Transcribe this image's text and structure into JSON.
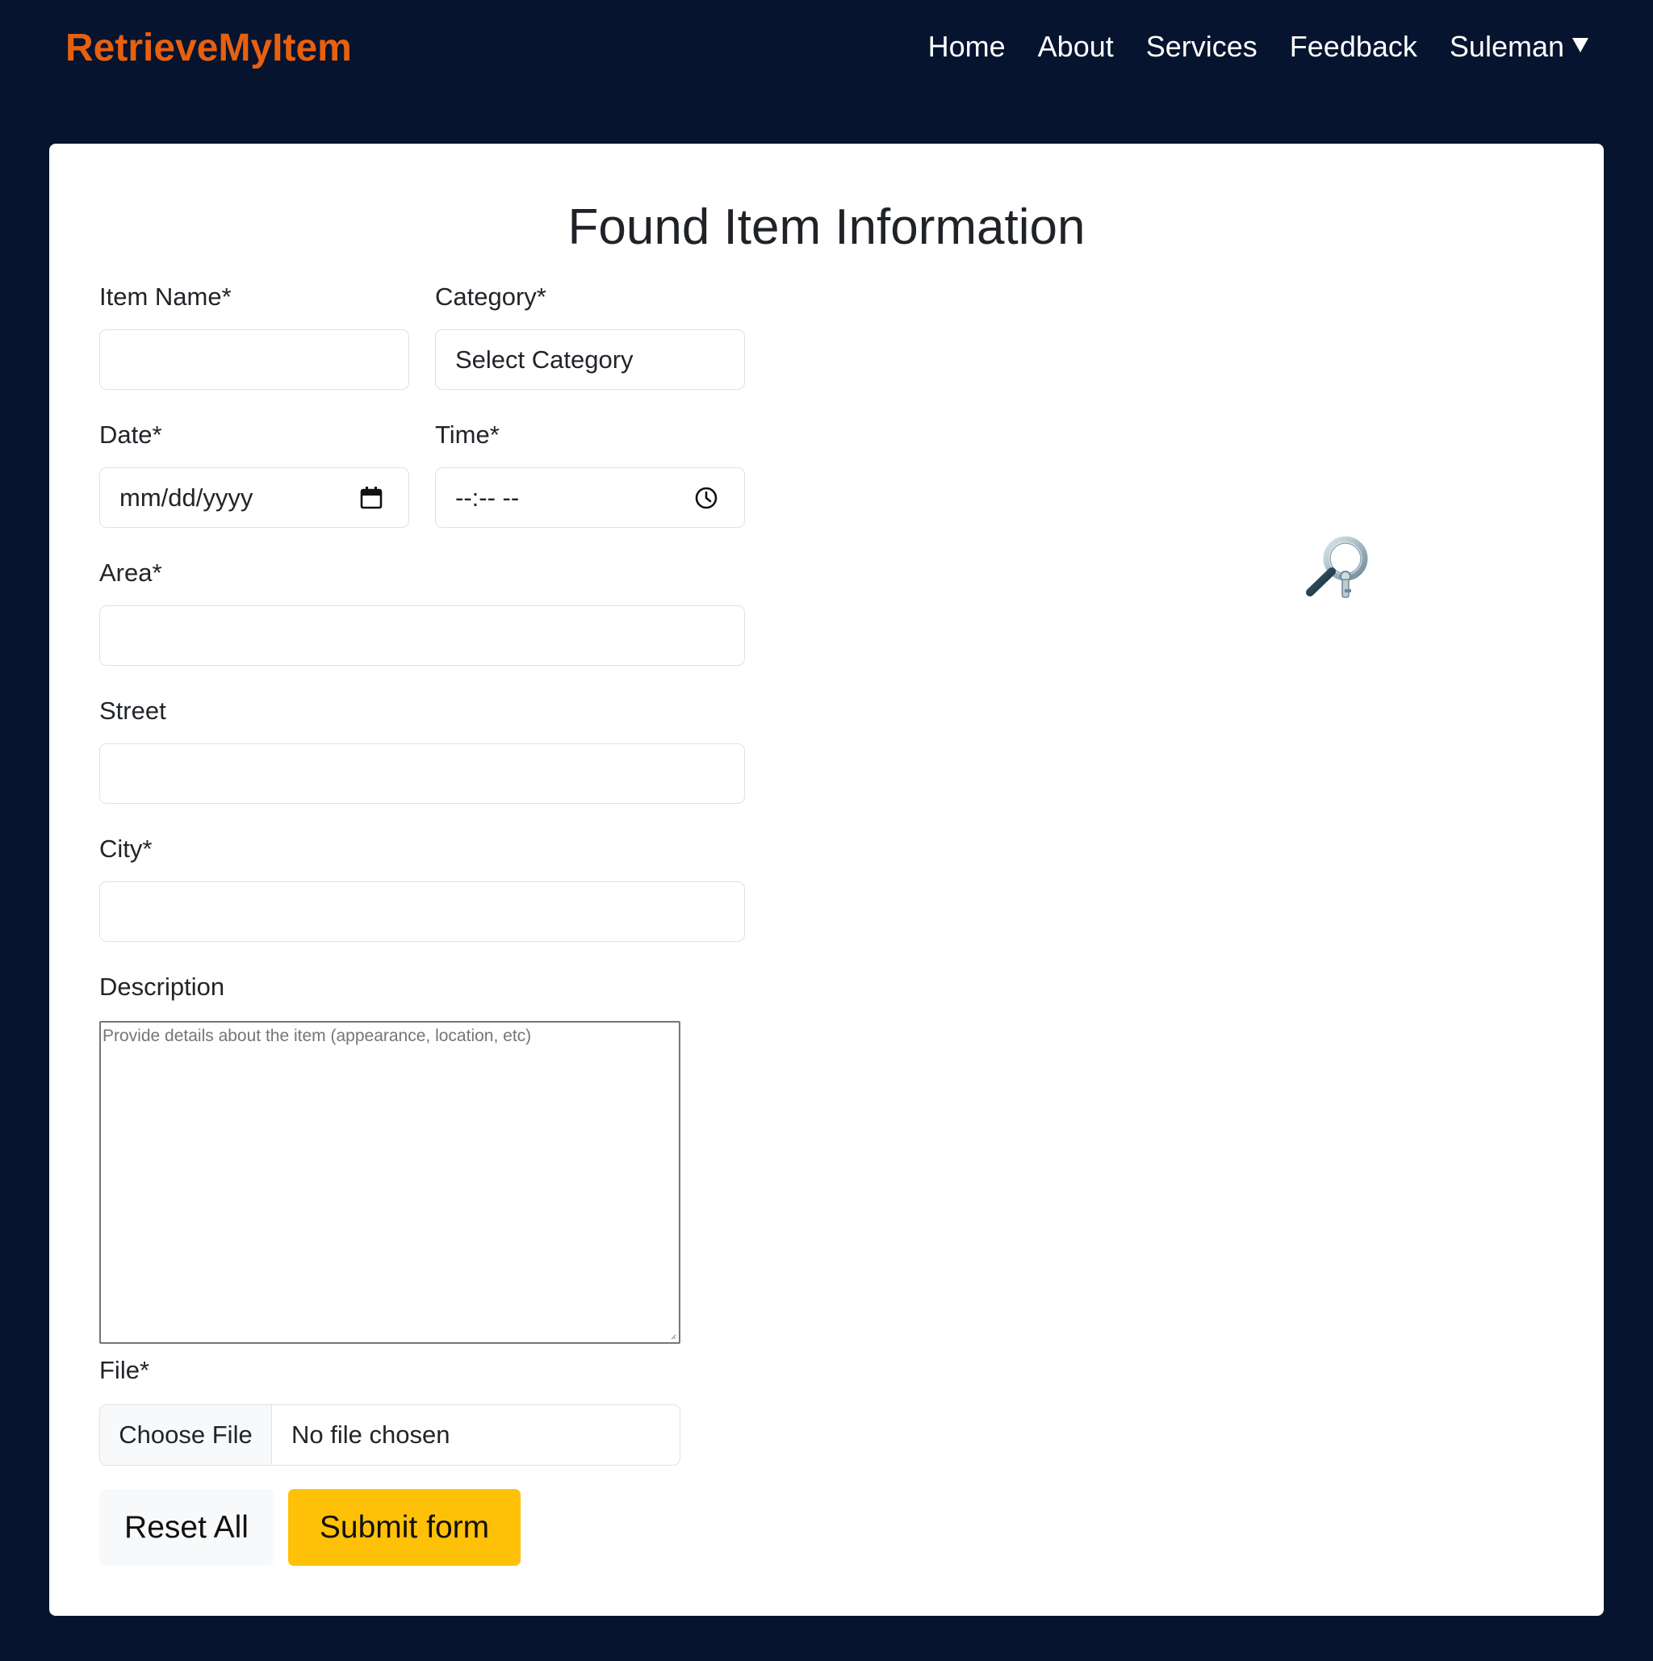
{
  "navbar": {
    "brand": "RetrieveMyItem",
    "links": [
      "Home",
      "About",
      "Services",
      "Feedback"
    ],
    "user": "Suleman",
    "colors": {
      "brand": "#e8600e",
      "background": "#06142f"
    }
  },
  "form": {
    "title": "Found Item Information",
    "item_name_label": "Item Name*",
    "item_name_value": "",
    "category_label": "Category*",
    "category_selected": "Select Category",
    "date_label": "Date*",
    "date_placeholder": "mm/dd/yyyy",
    "time_label": "Time*",
    "time_placeholder": "--:-- --",
    "area_label": "Area*",
    "area_value": "",
    "street_label": "Street",
    "street_value": "",
    "city_label": "City*",
    "city_value": "",
    "description_label": "Description",
    "description_placeholder": "Provide details about the  item (appearance, location, etc)",
    "file_label": "File*",
    "file_button": "Choose File",
    "file_status": "No file chosen",
    "reset_button": "Reset All",
    "submit_button": "Submit form",
    "colors": {
      "submit": "#ffc107"
    }
  },
  "icons": {
    "date": "calendar-icon",
    "time": "clock-icon",
    "illustration": "magnifying-glass-icon",
    "user_menu": "caret-down-icon"
  }
}
